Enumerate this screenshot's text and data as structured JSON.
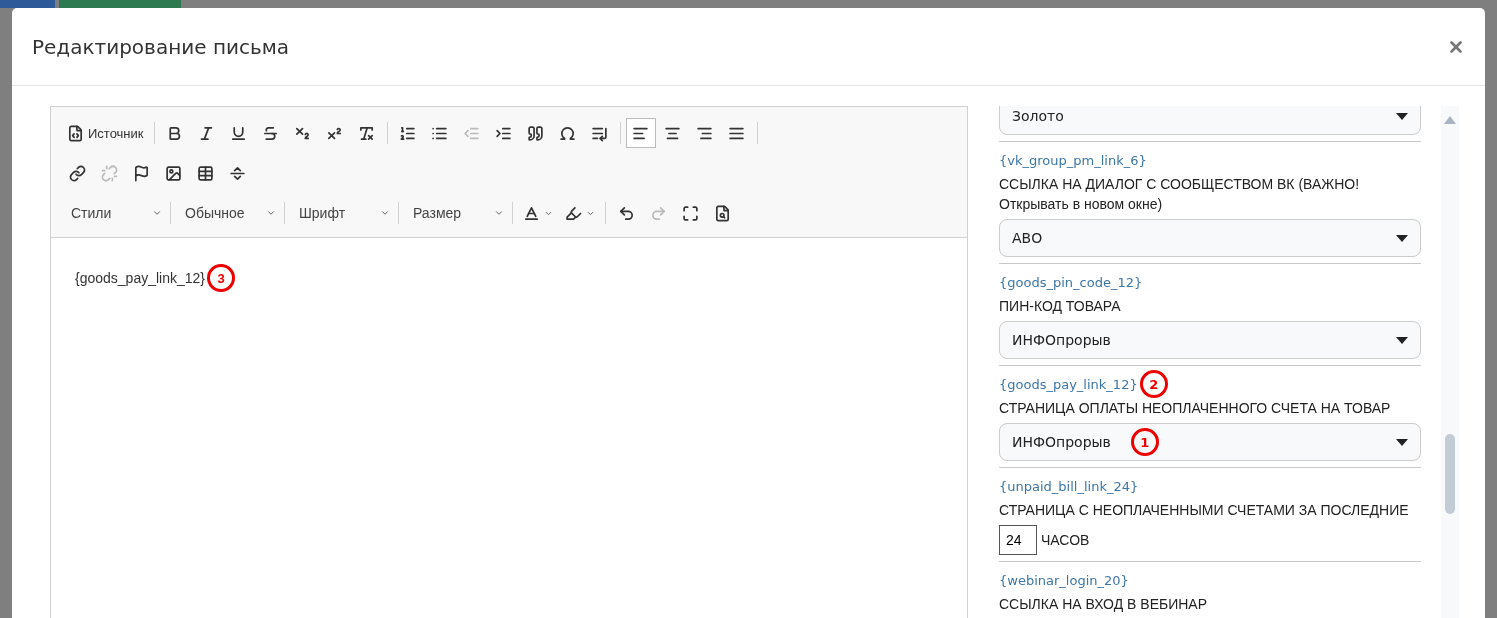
{
  "background": {
    "buttons": [
      {
        "kind": "primary"
      },
      {
        "kind": "success"
      }
    ]
  },
  "window": {
    "title": "Редактирование письма"
  },
  "editor": {
    "toolbar_rows": [
      [
        {
          "kind": "source",
          "label": "Источник",
          "selected": false,
          "disabled": false
        },
        {
          "kind": "sep"
        },
        {
          "kind": "bold",
          "selected": false,
          "disabled": false
        },
        {
          "kind": "italic",
          "selected": false,
          "disabled": false
        },
        {
          "kind": "underline",
          "selected": false,
          "disabled": false
        },
        {
          "kind": "strike",
          "selected": false,
          "disabled": false
        },
        {
          "kind": "subscript",
          "selected": false,
          "disabled": false
        },
        {
          "kind": "superscript",
          "selected": false,
          "disabled": false
        },
        {
          "kind": "clear",
          "selected": false,
          "disabled": false
        },
        {
          "kind": "sep"
        },
        {
          "kind": "ordered",
          "selected": false,
          "disabled": false
        },
        {
          "kind": "bullets",
          "selected": false,
          "disabled": false
        },
        {
          "kind": "outdent",
          "selected": false,
          "disabled": true
        },
        {
          "kind": "indent",
          "selected": false,
          "disabled": false
        },
        {
          "kind": "quote",
          "selected": false,
          "disabled": false
        },
        {
          "kind": "omega",
          "selected": false,
          "disabled": false
        },
        {
          "kind": "blockindent",
          "selected": false,
          "disabled": false
        },
        {
          "kind": "sep"
        },
        {
          "kind": "alignleft",
          "selected": true,
          "disabled": false
        },
        {
          "kind": "aligncenter",
          "selected": false,
          "disabled": false
        },
        {
          "kind": "alignright",
          "selected": false,
          "disabled": false
        },
        {
          "kind": "justify",
          "selected": false,
          "disabled": false
        },
        {
          "kind": "sep"
        }
      ],
      [
        {
          "kind": "link",
          "selected": false,
          "disabled": false
        },
        {
          "kind": "unlink",
          "selected": false,
          "disabled": true
        },
        {
          "kind": "flag",
          "selected": false,
          "disabled": false
        },
        {
          "kind": "image",
          "selected": false,
          "disabled": false
        },
        {
          "kind": "table",
          "selected": false,
          "disabled": false
        },
        {
          "kind": "hr",
          "selected": false,
          "disabled": false
        }
      ],
      [
        {
          "kind": "combo",
          "label": "Стили"
        },
        {
          "kind": "sep"
        },
        {
          "kind": "combo",
          "label": "Обычное"
        },
        {
          "kind": "sep"
        },
        {
          "kind": "combo",
          "label": "Шрифт"
        },
        {
          "kind": "sep"
        },
        {
          "kind": "combo",
          "label": "Размер"
        },
        {
          "kind": "sep"
        },
        {
          "kind": "textcolor",
          "selected": false,
          "disabled": false
        },
        {
          "kind": "bgcolor",
          "selected": false,
          "disabled": false
        },
        {
          "kind": "sep"
        },
        {
          "kind": "undo",
          "selected": false,
          "disabled": false
        },
        {
          "kind": "redo",
          "selected": false,
          "disabled": true
        },
        {
          "kind": "maximize",
          "selected": false,
          "disabled": false
        },
        {
          "kind": "preview",
          "selected": false,
          "disabled": false
        }
      ]
    ],
    "content": "{goods_pay_link_12}",
    "annotation": "3"
  },
  "variables": [
    {
      "kind": "select",
      "value": "Золото"
    },
    {
      "kind": "select",
      "token": "{vk_group_pm_link_6}",
      "label": "ССЫЛКА НА ДИАЛОГ С СООБЩЕСТВОМ ВК (ВАЖНО! Открывать в новом окне)",
      "value": "АВО"
    },
    {
      "kind": "select",
      "token": "{goods_pin_code_12}",
      "label": "ПИН-КОД ТОВАРА",
      "value": "ИНФОпрорыв"
    },
    {
      "kind": "select",
      "token": "{goods_pay_link_12}",
      "token_annotation": "2",
      "label": "СТРАНИЦА ОПЛАТЫ НЕОПЛАЧЕННОГО СЧЕТА НА ТОВАР",
      "value": "ИНФОпрорыв",
      "value_annotation": "1"
    },
    {
      "kind": "number",
      "token": "{unpaid_bill_link_24}",
      "label": "СТРАНИЦА С НЕОПЛАЧЕННЫМИ СЧЕТАМИ ЗА ПОСЛЕДНИЕ",
      "value": "24",
      "suffix": "ЧАСОВ"
    },
    {
      "kind": "text",
      "token": "{webinar_login_20}",
      "label": "ССЫЛКА НА ВХОД В ВЕБИНАР"
    }
  ]
}
